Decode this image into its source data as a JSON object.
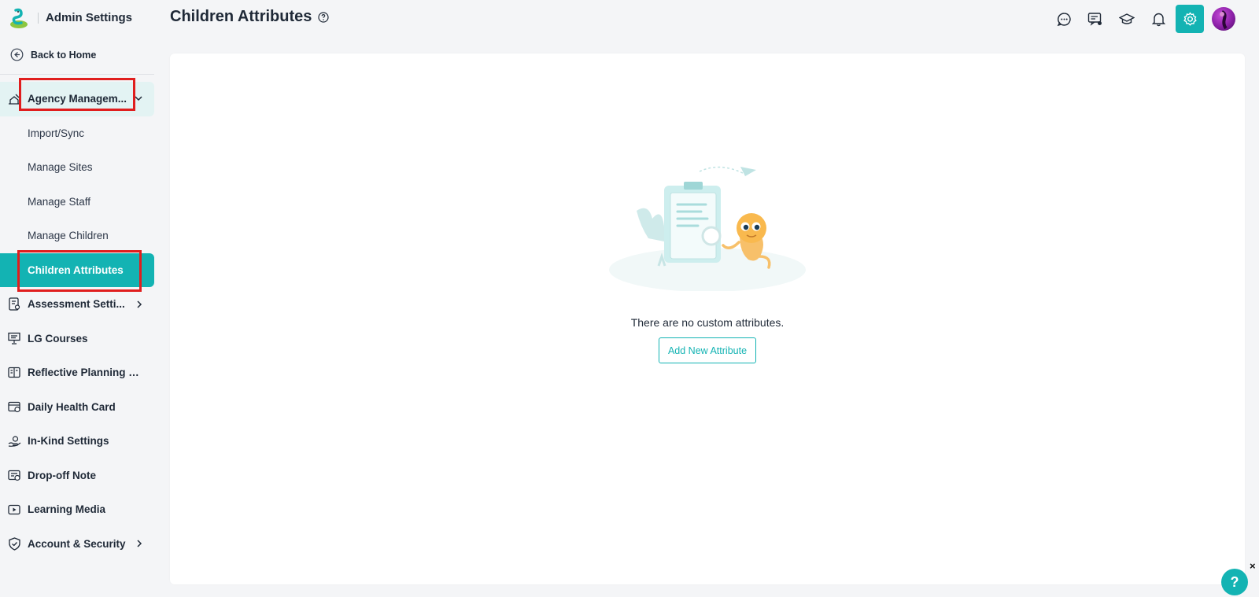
{
  "brand": {
    "title": "Admin Settings",
    "logo_icon": "app-logo"
  },
  "back": {
    "label": "Back to Home",
    "icon": "back-arrow-icon"
  },
  "page": {
    "title": "Children Attributes",
    "help_icon": "question-icon"
  },
  "sidebar": {
    "group": {
      "label": "Agency Managem...",
      "icon": "agency-icon",
      "expanded": true
    },
    "sub_items": [
      {
        "label": "Import/Sync"
      },
      {
        "label": "Manage Sites"
      },
      {
        "label": "Manage Staff"
      },
      {
        "label": "Manage Children"
      },
      {
        "label": "Children Attributes",
        "active": true
      }
    ],
    "items": [
      {
        "label": "Assessment Setti...",
        "icon": "assessment-icon",
        "chevron": true
      },
      {
        "label": "LG Courses",
        "icon": "courses-icon"
      },
      {
        "label": "Reflective Planning S...",
        "icon": "reflective-icon"
      },
      {
        "label": "Daily Health Card",
        "icon": "health-card-icon"
      },
      {
        "label": "In-Kind Settings",
        "icon": "in-kind-icon"
      },
      {
        "label": "Drop-off Note",
        "icon": "note-icon"
      },
      {
        "label": "Learning Media",
        "icon": "media-icon"
      },
      {
        "label": "Account & Security",
        "icon": "shield-icon",
        "chevron": true
      }
    ]
  },
  "topbar": {
    "icons": [
      "chat-icon",
      "feedback-icon",
      "graduation-icon",
      "bell-icon",
      "settings-icon"
    ],
    "active": "settings-icon"
  },
  "main": {
    "empty_text": "There are no custom attributes.",
    "add_button": "Add New Attribute"
  },
  "help_fab": {
    "label": "?",
    "close": "×"
  },
  "colors": {
    "accent": "#13b3b3",
    "highlight": "#e01e1e",
    "active_bg": "#e3f3f3"
  }
}
